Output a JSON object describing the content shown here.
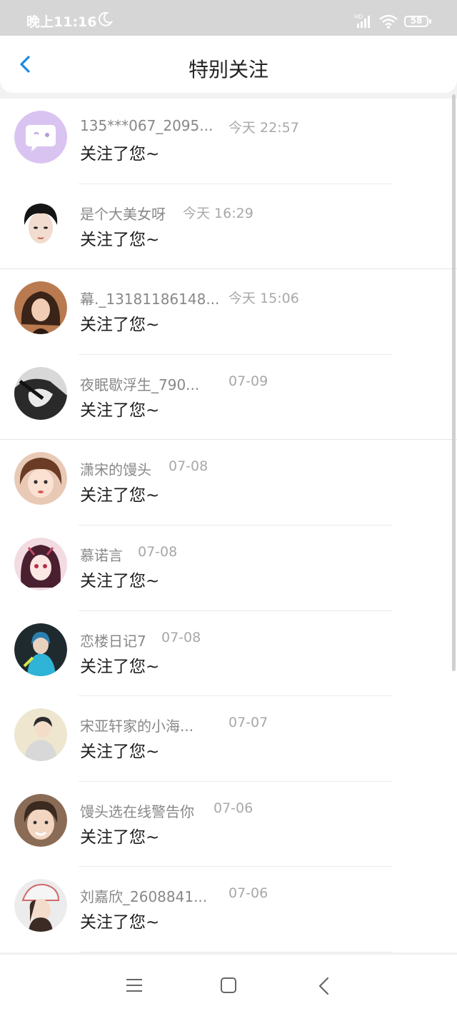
{
  "status_bar": {
    "time": "晚上11:16",
    "signal_label": "HD",
    "battery": "58"
  },
  "header": {
    "title": "特别关注"
  },
  "colors": {
    "accent": "#1e88e5",
    "status_bar_bg": "#d6d6d6"
  },
  "items": [
    {
      "name": "135***067_2095...",
      "time": "今天 22:57",
      "message": "关注了您~"
    },
    {
      "name": "是个大美女呀",
      "time": "今天 16:29",
      "message": "关注了您~"
    },
    {
      "name": "幕._13181186148...",
      "time": "今天 15:06",
      "message": "关注了您~"
    },
    {
      "name": "夜眠歇浮生_790...",
      "time": "07-09",
      "message": "关注了您~"
    },
    {
      "name": "潇宋的馒头",
      "time": "07-08",
      "message": "关注了您~"
    },
    {
      "name": "慕诺言",
      "time": "07-08",
      "message": "关注了您~"
    },
    {
      "name": "恋楼日记7",
      "time": "07-08",
      "message": "关注了您~"
    },
    {
      "name": "宋亚轩家的小海...",
      "time": "07-07",
      "message": "关注了您~"
    },
    {
      "name": "馒头选在线警告你",
      "time": "07-06",
      "message": "关注了您~"
    },
    {
      "name": "刘嘉欣_2608841...",
      "time": "07-06",
      "message": "关注了您~"
    }
  ]
}
